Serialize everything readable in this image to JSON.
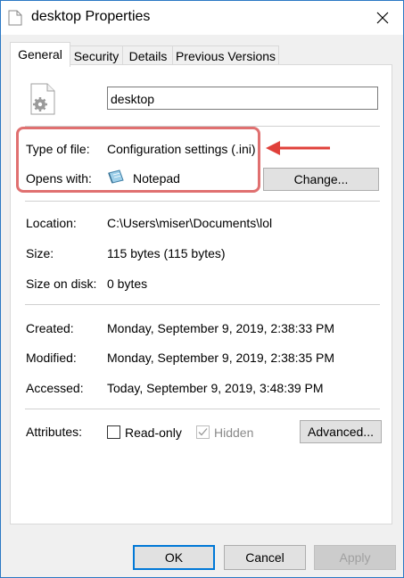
{
  "window": {
    "title": "desktop Properties"
  },
  "tabs": [
    {
      "label": "General",
      "active": true
    },
    {
      "label": "Security"
    },
    {
      "label": "Details"
    },
    {
      "label": "Previous Versions"
    }
  ],
  "file": {
    "name": "desktop"
  },
  "type_of_file": {
    "label": "Type of file:",
    "value": "Configuration settings (.ini)"
  },
  "opens_with": {
    "label": "Opens with:",
    "value": "Notepad",
    "change_button": "Change..."
  },
  "location": {
    "label": "Location:",
    "value": "C:\\Users\\miser\\Documents\\lol"
  },
  "size": {
    "label": "Size:",
    "value": "115 bytes (115 bytes)"
  },
  "size_on_disk": {
    "label": "Size on disk:",
    "value": "0 bytes"
  },
  "created": {
    "label": "Created:",
    "value": "Monday, September 9, 2019, 2:38:33 PM"
  },
  "modified": {
    "label": "Modified:",
    "value": "Monday, September 9, 2019, 2:38:35 PM"
  },
  "accessed": {
    "label": "Accessed:",
    "value": "Today, September 9, 2019, 3:48:39 PM"
  },
  "attributes": {
    "label": "Attributes:",
    "read_only": {
      "label": "Read-only",
      "checked": false
    },
    "hidden": {
      "label": "Hidden",
      "checked": true,
      "disabled": true
    },
    "advanced_button": "Advanced..."
  },
  "footer": {
    "ok": "OK",
    "cancel": "Cancel",
    "apply": "Apply"
  },
  "colors": {
    "accent": "#0078d7",
    "annotation": "#e0403a",
    "highlight_border": "#e07070"
  }
}
